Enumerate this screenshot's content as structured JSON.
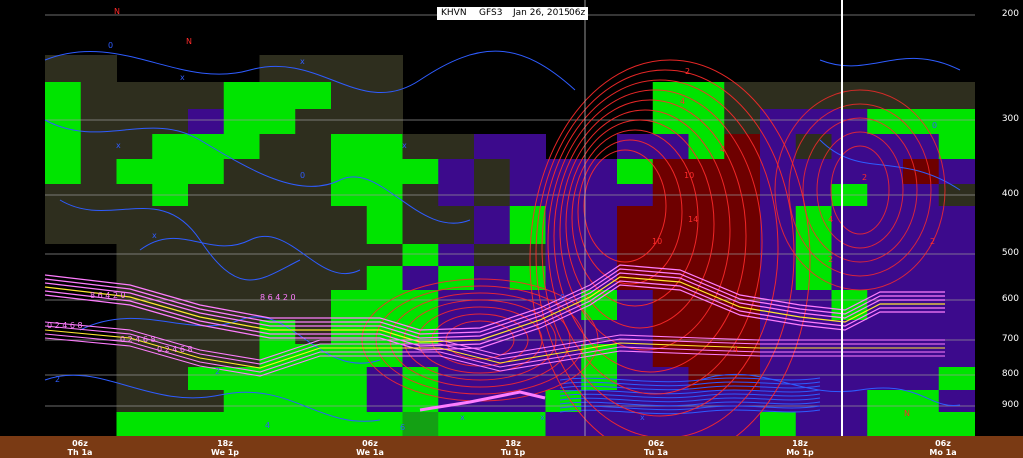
{
  "header": {
    "station": "KHVN",
    "model": "GFS3",
    "run_date": "Jan 26, 2015",
    "run_hour": "06z"
  },
  "pressure_levels": [
    "200",
    "300",
    "400",
    "500",
    "600",
    "700",
    "800",
    "900"
  ],
  "time_axis": [
    {
      "hour": "06z",
      "day": "Th 1a"
    },
    {
      "hour": "18z",
      "day": "We 1p"
    },
    {
      "hour": "06z",
      "day": "We 1a"
    },
    {
      "hour": "18z",
      "day": "Tu 1p"
    },
    {
      "hour": "06z",
      "day": "Tu 1a"
    },
    {
      "hour": "18z",
      "day": "Mo 1p"
    },
    {
      "hour": "06z",
      "day": "Mo 1a"
    }
  ],
  "colors": {
    "background": "#000000",
    "time_bar": "#7a3a14",
    "dry_cell": "#2e2e1e",
    "moist_light": "#00e400",
    "moist_dark": "#14a014",
    "purple_cell": "#3c0a8c",
    "red_cell": "#6e0000",
    "temp_contour": "#2e5cff",
    "omega_contour": "#ff2a2a",
    "isotherm_band": "#ff7dff",
    "isotherm_band_2": "#ffe633"
  },
  "chart_data": {
    "type": "heatmap",
    "title": "KHVN GFS3 Jan 26, 2015 06z",
    "x_labels": [
      "06z Th 1a",
      "18z We 1p",
      "06z We 1a",
      "18z Tu 1p",
      "06z Tu 1a",
      "18z Mo 1p",
      "06z Mo 1a"
    ],
    "y_labels": [
      "200",
      "300",
      "400",
      "500",
      "600",
      "700",
      "800",
      "900"
    ],
    "ylim": [
      200,
      900
    ],
    "x_ticks_shown_right_to_left": true,
    "current_time_marker": "between 18z Mo 1p and 06z Mo 1a",
    "grid": true,
    "contour_labels_temperature": [
      "0",
      "2",
      "4",
      "6",
      "8",
      "0 2 4 6 8",
      "8 6 4 2 0"
    ],
    "contour_labels_omega": [
      "2",
      "4",
      "6",
      "8",
      "10",
      "14"
    ],
    "wind_markers": [
      "N",
      "x"
    ]
  }
}
